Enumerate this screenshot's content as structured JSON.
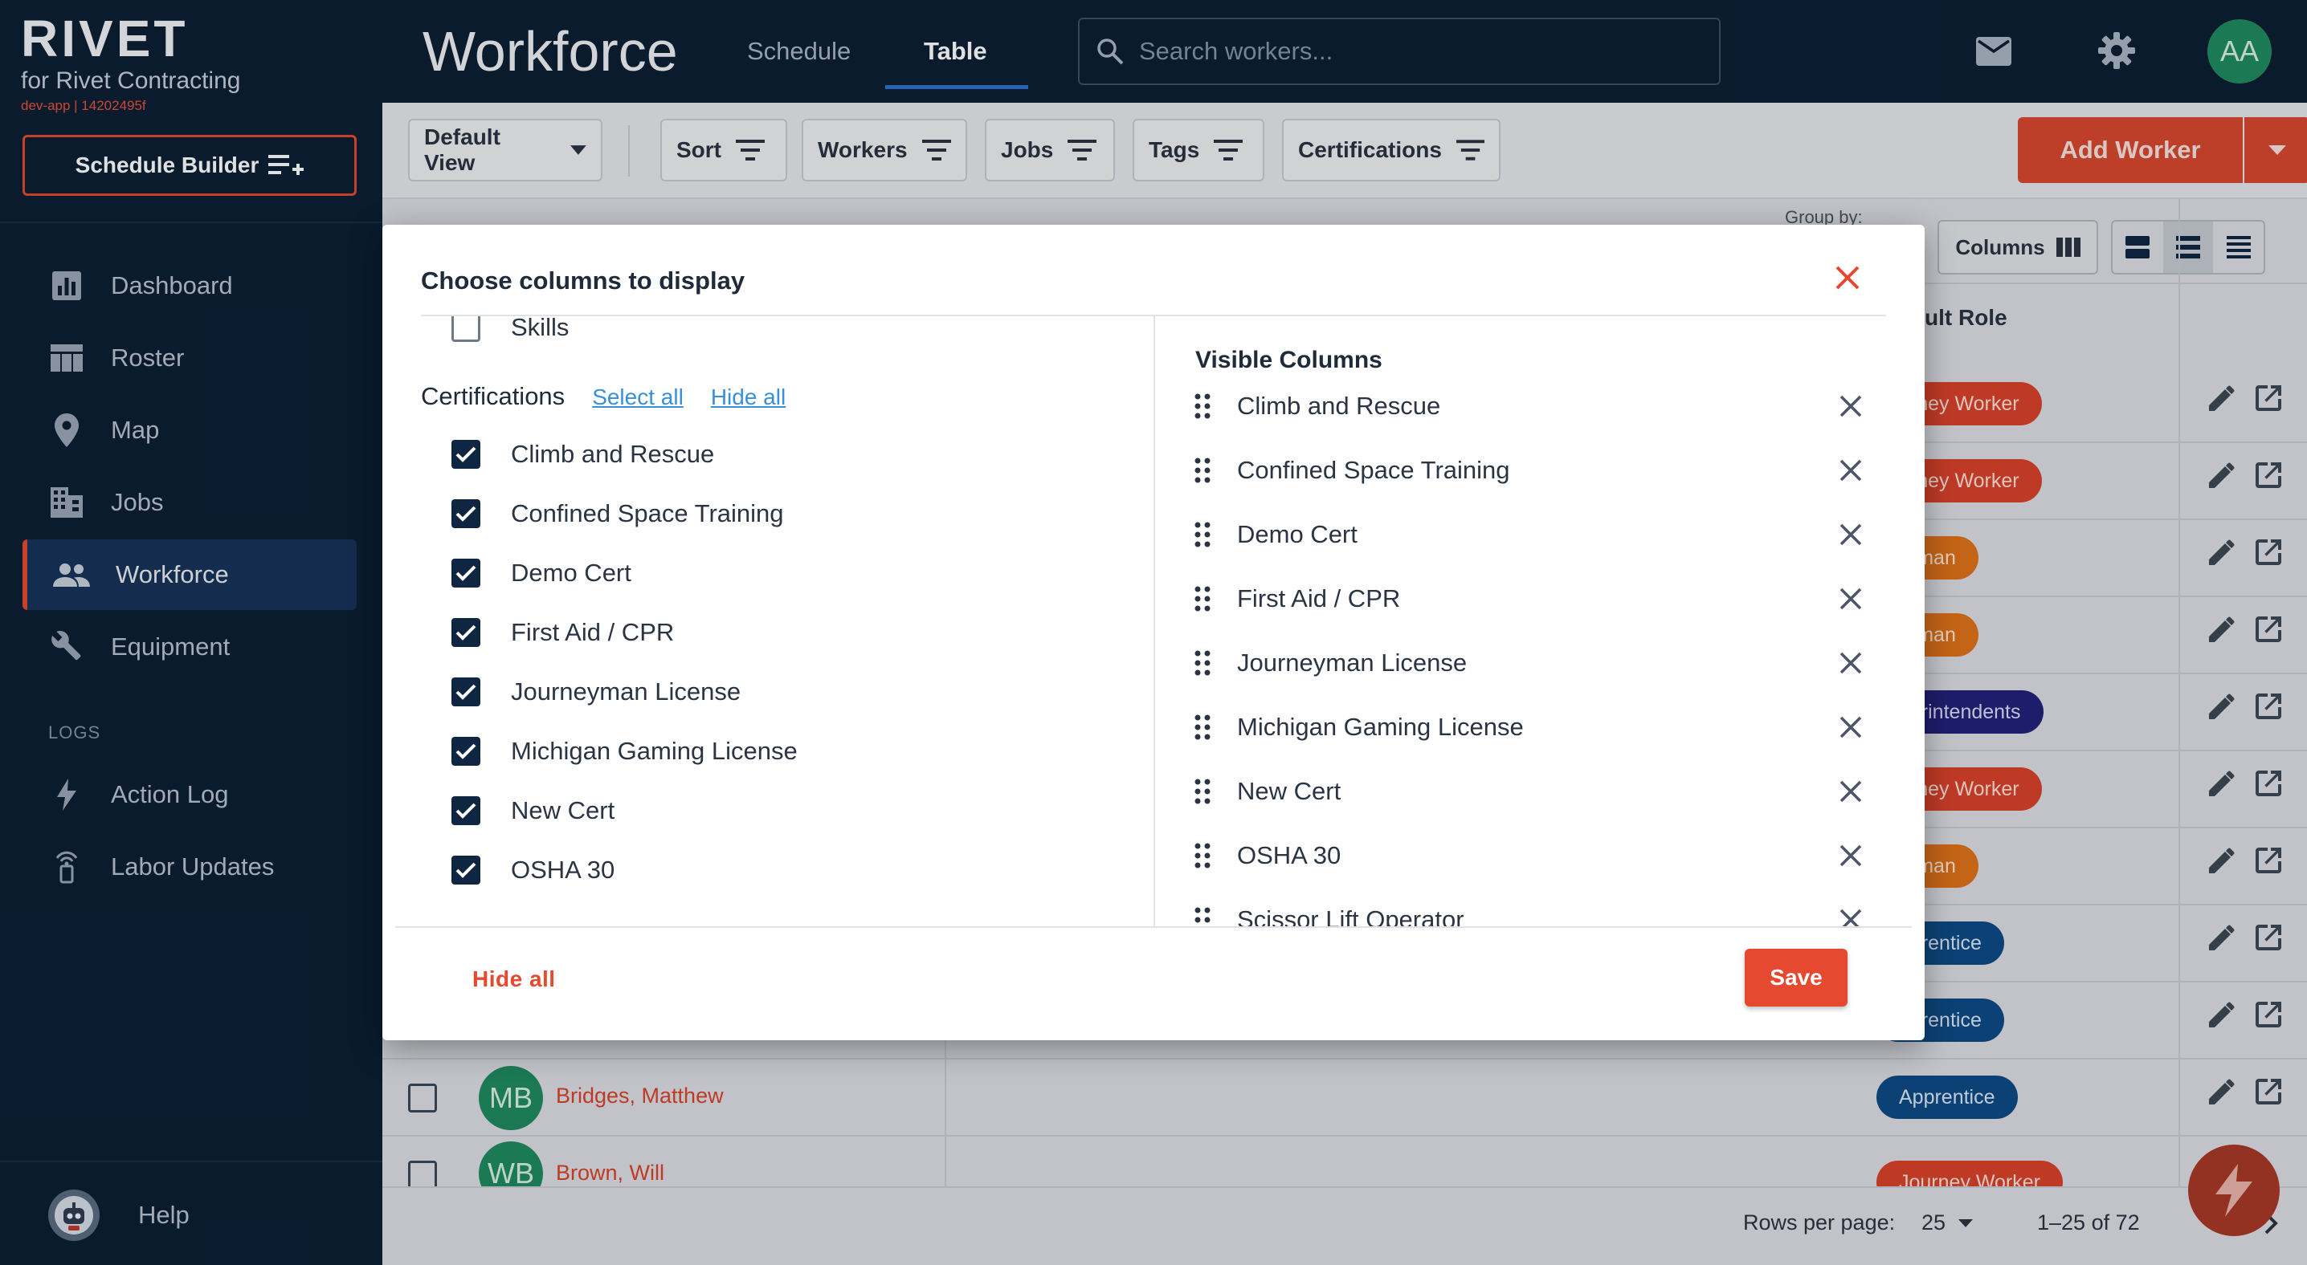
{
  "brand": {
    "logo": "RIVET",
    "company": "for Rivet Contracting",
    "env": "dev-app | 14202495f"
  },
  "sidebar": {
    "schedule_builder": "Schedule Builder",
    "items": [
      {
        "label": "Dashboard",
        "icon": "chart-icon"
      },
      {
        "label": "Roster",
        "icon": "table-icon"
      },
      {
        "label": "Map",
        "icon": "pin-icon"
      },
      {
        "label": "Jobs",
        "icon": "building-icon"
      },
      {
        "label": "Workforce",
        "icon": "people-icon"
      },
      {
        "label": "Equipment",
        "icon": "wrench-icon"
      }
    ],
    "logs_heading": "LOGS",
    "log_items": [
      {
        "label": "Action Log",
        "icon": "bolt-icon"
      },
      {
        "label": "Labor Updates",
        "icon": "tower-icon"
      }
    ],
    "help": "Help"
  },
  "topbar": {
    "title": "Workforce",
    "tabs": [
      "Schedule",
      "Table"
    ],
    "active_tab": "Table",
    "search_placeholder": "Search workers...",
    "avatar_initials": "AA"
  },
  "toolbar": {
    "default_view": "Default View",
    "filters": [
      "Sort",
      "Workers",
      "Jobs",
      "Tags",
      "Certifications"
    ],
    "add_worker": "Add Worker"
  },
  "table": {
    "group_by": "Group by:",
    "columns_button": "Columns",
    "role_header": "ult Role",
    "rows": [
      {
        "role": "urney Worker",
        "color": "#d9432b"
      },
      {
        "role": "urney Worker",
        "color": "#d9432b"
      },
      {
        "role": "reman",
        "color": "#e0721b"
      },
      {
        "role": "reman",
        "color": "#e0721b"
      },
      {
        "role": "perintendents",
        "color": "#23217a"
      },
      {
        "role": "urney Worker",
        "color": "#d9432b"
      },
      {
        "role": "reman",
        "color": "#e0721b"
      },
      {
        "role": "pprentice",
        "color": "#0e4a86"
      },
      {
        "role": "pprentice",
        "color": "#0e4a86"
      },
      {
        "initials": "MB",
        "name": "Bridges, Matthew",
        "role": "Apprentice",
        "color": "#0e4a86"
      },
      {
        "initials": "WB",
        "name": "Brown, Will",
        "role": "Journey Worker",
        "color": "#d9432b"
      }
    ],
    "rows_per_page_label": "Rows per page:",
    "rows_per_page": "25",
    "range": "1–25 of 72"
  },
  "modal": {
    "title": "Choose columns to display",
    "skills_label": "Skills",
    "cert_heading": "Certifications",
    "select_all": "Select all",
    "hide_all_link": "Hide all",
    "cert_items": [
      "Climb and Rescue",
      "Confined Space Training",
      "Demo Cert",
      "First Aid / CPR",
      "Journeyman License",
      "Michigan Gaming License",
      "New Cert",
      "OSHA 30"
    ],
    "visible_title": "Visible Columns",
    "visible_items": [
      "Climb and Rescue",
      "Confined Space Training",
      "Demo Cert",
      "First Aid / CPR",
      "Journeyman License",
      "Michigan Gaming License",
      "New Cert",
      "OSHA 30",
      "Scissor Lift Operator"
    ],
    "hide_all_button": "Hide all",
    "save_button": "Save"
  },
  "colors": {
    "navy": "#0c1f35",
    "accent": "#e5492f",
    "checkbox": "#0f2642",
    "link": "#3a8fd9"
  }
}
